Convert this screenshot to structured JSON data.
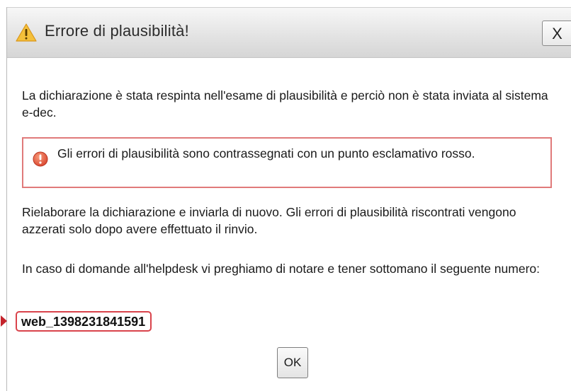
{
  "dialog": {
    "title": "Errore di plausibilità!",
    "close_label": "X",
    "ok_label": "OK"
  },
  "message": {
    "paragraph1": "La dichiarazione è stata respinta nell'esame di plausibilità e perciò non è stata inviata al sistema e-dec.",
    "error_notice": "Gli errori di plausibilità sono contrassegnati con un punto esclamativo rosso.",
    "paragraph2": "Rielaborare la dichiarazione e inviarla di nuovo. Gli errori di plausibilità riscontrati vengono azzerati solo dopo avere effettuato il rinvio.",
    "paragraph3": "In caso di domande all'helpdesk vi preghiamo di notare e tener sottomano il seguente numero:",
    "reference_number": "web_1398231841591"
  },
  "icons": {
    "title": "warning-triangle-icon",
    "notice": "error-exclamation-icon"
  },
  "colors": {
    "error_border": "#e07a7a",
    "highlight": "#d9434b",
    "warning": "#f2b21b"
  }
}
